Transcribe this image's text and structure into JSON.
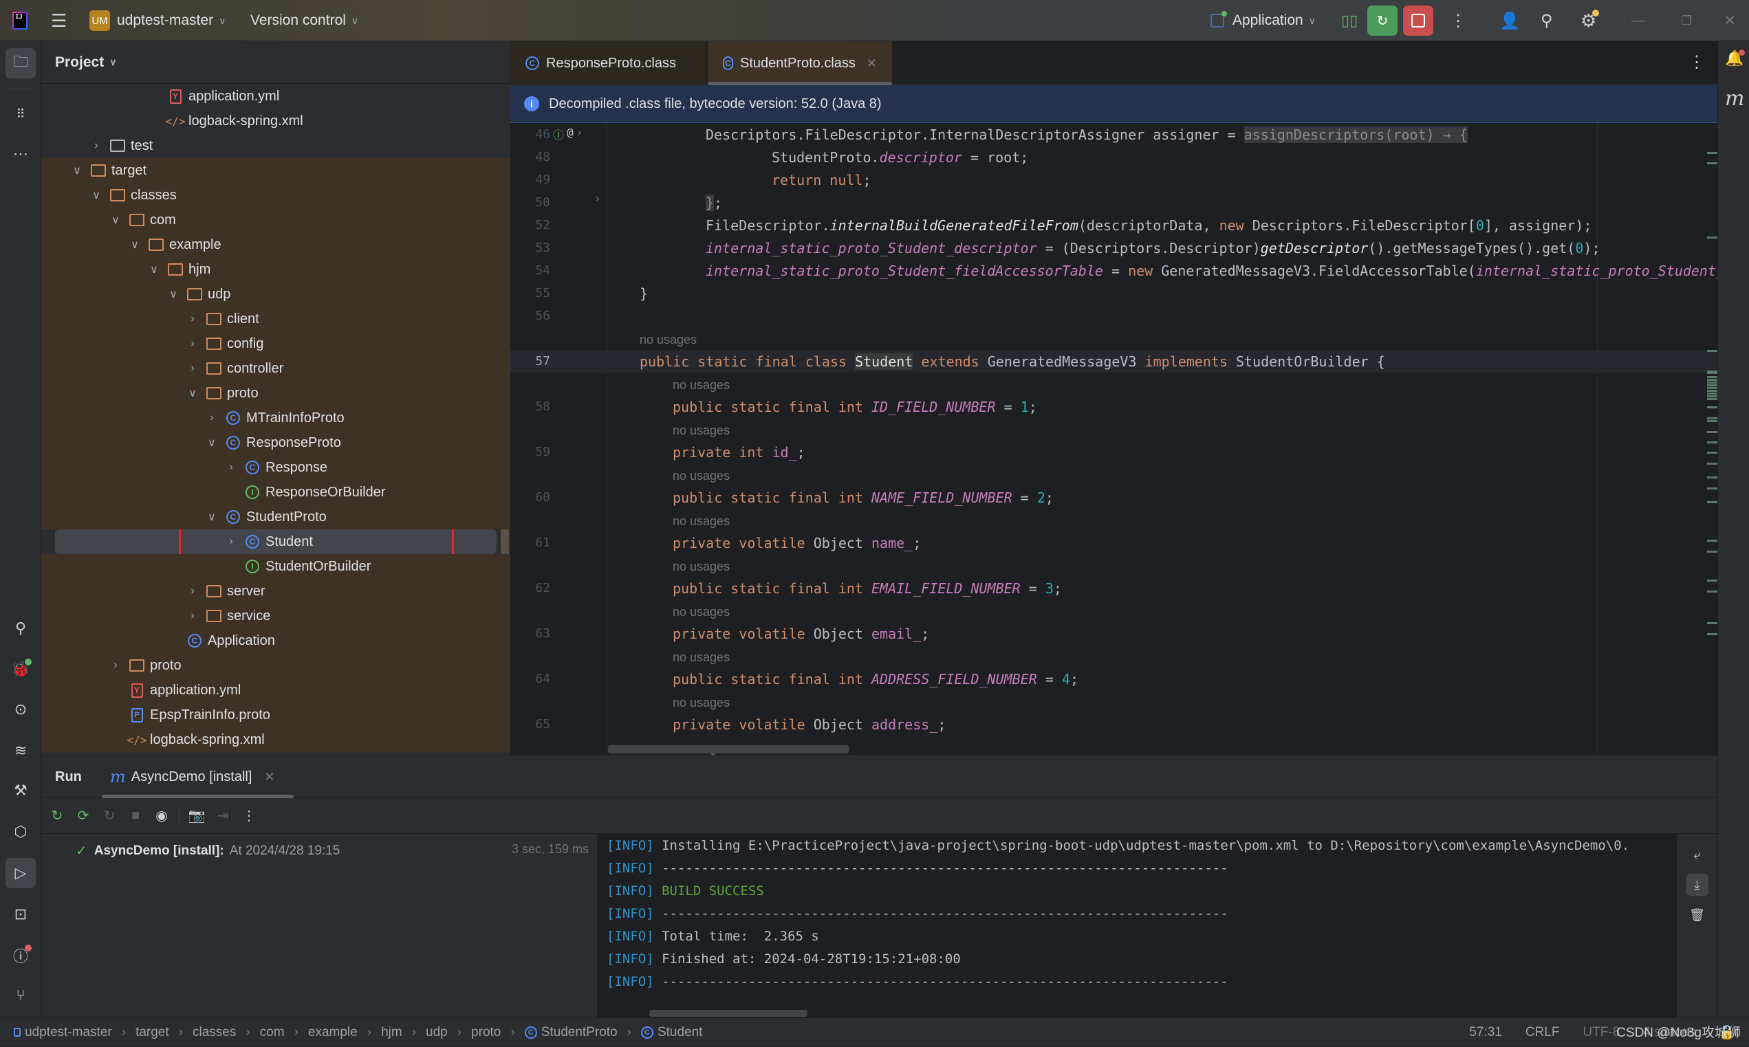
{
  "titlebar": {
    "project_badge": "UM",
    "project_name": "udptest-master",
    "vcs_label": "Version control",
    "run_config": "Application"
  },
  "colors": {
    "accent_blue": "#548af7",
    "interface_green": "#5fb865",
    "highlight_red": "#e8212b",
    "run_green": "#4e9a5b",
    "stop_red": "#c94f4f",
    "excluded_bg": "#3e3224"
  },
  "left_strip": {
    "top_icons": [
      "folder-icon",
      "structure-icon",
      "more-icon"
    ],
    "bottom_icons": [
      "search-icon",
      "debug-icon",
      "services-icon",
      "layers-icon",
      "build-icon",
      "endpoints-icon",
      "run-icon",
      "terminal-icon",
      "problems-icon",
      "git-icon"
    ]
  },
  "project": {
    "title": "Project",
    "tree": [
      {
        "label": "application.yml",
        "icon": "yml",
        "depth": 5,
        "arrow": "",
        "excluded": false
      },
      {
        "label": "logback-spring.xml",
        "icon": "xml",
        "depth": 5,
        "arrow": "",
        "excluded": false
      },
      {
        "label": "test",
        "icon": "folder-plain",
        "depth": 2,
        "arrow": "collapsed",
        "excluded": false
      },
      {
        "label": "target",
        "icon": "folder",
        "depth": 1,
        "arrow": "expanded",
        "excluded": true
      },
      {
        "label": "classes",
        "icon": "folder",
        "depth": 2,
        "arrow": "expanded",
        "excluded": true
      },
      {
        "label": "com",
        "icon": "folder",
        "depth": 3,
        "arrow": "expanded",
        "excluded": true
      },
      {
        "label": "example",
        "icon": "folder",
        "depth": 4,
        "arrow": "expanded",
        "excluded": true
      },
      {
        "label": "hjm",
        "icon": "folder",
        "depth": 5,
        "arrow": "expanded",
        "excluded": true
      },
      {
        "label": "udp",
        "icon": "folder",
        "depth": 6,
        "arrow": "expanded",
        "excluded": true
      },
      {
        "label": "client",
        "icon": "folder",
        "depth": 7,
        "arrow": "collapsed",
        "excluded": true
      },
      {
        "label": "config",
        "icon": "folder",
        "depth": 7,
        "arrow": "collapsed",
        "excluded": true
      },
      {
        "label": "controller",
        "icon": "folder",
        "depth": 7,
        "arrow": "collapsed",
        "excluded": true
      },
      {
        "label": "proto",
        "icon": "folder",
        "depth": 7,
        "arrow": "expanded",
        "excluded": true
      },
      {
        "label": "MTrainInfoProto",
        "icon": "class",
        "depth": 8,
        "arrow": "collapsed",
        "excluded": true
      },
      {
        "label": "ResponseProto",
        "icon": "class",
        "depth": 8,
        "arrow": "expanded",
        "excluded": true
      },
      {
        "label": "Response",
        "icon": "class",
        "depth": 9,
        "arrow": "collapsed",
        "excluded": true
      },
      {
        "label": "ResponseOrBuilder",
        "icon": "interface",
        "depth": 9,
        "arrow": "",
        "excluded": true
      },
      {
        "label": "StudentProto",
        "icon": "class",
        "depth": 8,
        "arrow": "expanded",
        "excluded": true
      },
      {
        "label": "Student",
        "icon": "class",
        "depth": 9,
        "arrow": "collapsed",
        "excluded": true,
        "selected": true
      },
      {
        "label": "StudentOrBuilder",
        "icon": "interface",
        "depth": 9,
        "arrow": "",
        "excluded": true
      },
      {
        "label": "server",
        "icon": "folder",
        "depth": 7,
        "arrow": "collapsed",
        "excluded": true
      },
      {
        "label": "service",
        "icon": "folder",
        "depth": 7,
        "arrow": "collapsed",
        "excluded": true
      },
      {
        "label": "Application",
        "icon": "class",
        "depth": 6,
        "arrow": "",
        "excluded": true
      },
      {
        "label": "proto",
        "icon": "folder",
        "depth": 3,
        "arrow": "collapsed",
        "excluded": true
      },
      {
        "label": "application.yml",
        "icon": "yml",
        "depth": 3,
        "arrow": "",
        "excluded": true
      },
      {
        "label": "EpspTrainInfo.proto",
        "icon": "proto",
        "depth": 3,
        "arrow": "",
        "excluded": true
      },
      {
        "label": "logback-spring.xml",
        "icon": "xml",
        "depth": 3,
        "arrow": "",
        "excluded": true
      }
    ]
  },
  "editor": {
    "tabs": [
      {
        "label": "ResponseProto.class",
        "active": false
      },
      {
        "label": "StudentProto.class",
        "active": true
      }
    ],
    "banner": "Decompiled .class file, bytecode version: 52.0 (Java 8)",
    "lines": [
      {
        "num": "46",
        "indent": 2,
        "hint": false,
        "tokens": [
          [
            "pl",
            "Descriptors.FileDescriptor.InternalDescriptorAssigner assigner = "
          ],
          [
            "fold",
            "assignDescriptors(root) → {"
          ]
        ]
      },
      {
        "num": "48",
        "indent": 4,
        "hint": false,
        "tokens": [
          [
            "pl",
            "StudentProto."
          ],
          [
            "fld",
            "descriptor"
          ],
          [
            "pl",
            " = root;"
          ]
        ]
      },
      {
        "num": "49",
        "indent": 4,
        "hint": false,
        "tokens": [
          [
            "kw",
            "return null"
          ],
          [
            "pl",
            ";"
          ]
        ]
      },
      {
        "num": "50",
        "indent": 2,
        "hint": false,
        "tokens": [
          [
            "fold",
            "}"
          ],
          [
            "pl",
            ";"
          ]
        ]
      },
      {
        "num": "52",
        "indent": 2,
        "hint": false,
        "tokens": [
          [
            "pl",
            "FileDescriptor."
          ],
          [
            "it",
            "internalBuildGeneratedFileFrom"
          ],
          [
            "pl",
            "(descriptorData, "
          ],
          [
            "kw",
            "new"
          ],
          [
            "pl",
            " Descriptors.FileDescriptor["
          ],
          [
            "num",
            "0"
          ],
          [
            "pl",
            "], assigner);"
          ]
        ]
      },
      {
        "num": "53",
        "indent": 2,
        "hint": false,
        "tokens": [
          [
            "fld",
            "internal_static_proto_Student_descriptor"
          ],
          [
            "pl",
            " = (Descriptors.Descriptor)"
          ],
          [
            "it",
            "getDescriptor"
          ],
          [
            "pl",
            "().getMessageTypes().get("
          ],
          [
            "num",
            "0"
          ],
          [
            "pl",
            ");"
          ]
        ]
      },
      {
        "num": "54",
        "indent": 2,
        "hint": false,
        "tokens": [
          [
            "fld",
            "internal_static_proto_Student_fieldAccessorTable"
          ],
          [
            "pl",
            " = "
          ],
          [
            "kw",
            "new"
          ],
          [
            "pl",
            " GeneratedMessageV3.FieldAccessorTable("
          ],
          [
            "fld",
            "internal_static_proto_Student_desc"
          ]
        ]
      },
      {
        "num": "55",
        "indent": 0,
        "hint": false,
        "tokens": [
          [
            "pl",
            "}"
          ]
        ]
      },
      {
        "num": "56",
        "indent": 0,
        "hint": false,
        "tokens": []
      },
      {
        "num": "",
        "indent": 0,
        "hint": true,
        "tokens": [
          [
            "hint",
            "no usages"
          ]
        ]
      },
      {
        "num": "57",
        "indent": 0,
        "hint": false,
        "current": true,
        "tokens": [
          [
            "kw",
            "public static final class "
          ],
          [
            "symhl",
            "Student"
          ],
          [
            "kw",
            " extends "
          ],
          [
            "pl",
            "GeneratedMessageV3"
          ],
          [
            "kw",
            " implements "
          ],
          [
            "pl",
            "StudentOrBuilder {"
          ]
        ]
      },
      {
        "num": "",
        "indent": 1,
        "hint": true,
        "tokens": [
          [
            "hint",
            "no usages"
          ]
        ]
      },
      {
        "num": "58",
        "indent": 1,
        "hint": false,
        "tokens": [
          [
            "kw",
            "public static final int "
          ],
          [
            "fld",
            "ID_FIELD_NUMBER"
          ],
          [
            "pl",
            " = "
          ],
          [
            "num",
            "1"
          ],
          [
            "pl",
            ";"
          ]
        ]
      },
      {
        "num": "",
        "indent": 1,
        "hint": true,
        "tokens": [
          [
            "hint",
            "no usages"
          ]
        ]
      },
      {
        "num": "59",
        "indent": 1,
        "hint": false,
        "tokens": [
          [
            "kw",
            "private int "
          ],
          [
            "ivar",
            "id_"
          ],
          [
            "pl",
            ";"
          ]
        ]
      },
      {
        "num": "",
        "indent": 1,
        "hint": true,
        "tokens": [
          [
            "hint",
            "no usages"
          ]
        ]
      },
      {
        "num": "60",
        "indent": 1,
        "hint": false,
        "tokens": [
          [
            "kw",
            "public static final int "
          ],
          [
            "fld",
            "NAME_FIELD_NUMBER"
          ],
          [
            "pl",
            " = "
          ],
          [
            "num",
            "2"
          ],
          [
            "pl",
            ";"
          ]
        ]
      },
      {
        "num": "",
        "indent": 1,
        "hint": true,
        "tokens": [
          [
            "hint",
            "no usages"
          ]
        ]
      },
      {
        "num": "61",
        "indent": 1,
        "hint": false,
        "tokens": [
          [
            "kw",
            "private volatile "
          ],
          [
            "pl",
            "Object "
          ],
          [
            "ivar",
            "name_"
          ],
          [
            "pl",
            ";"
          ]
        ]
      },
      {
        "num": "",
        "indent": 1,
        "hint": true,
        "tokens": [
          [
            "hint",
            "no usages"
          ]
        ]
      },
      {
        "num": "62",
        "indent": 1,
        "hint": false,
        "tokens": [
          [
            "kw",
            "public static final int "
          ],
          [
            "fld",
            "EMAIL_FIELD_NUMBER"
          ],
          [
            "pl",
            " = "
          ],
          [
            "num",
            "3"
          ],
          [
            "pl",
            ";"
          ]
        ]
      },
      {
        "num": "",
        "indent": 1,
        "hint": true,
        "tokens": [
          [
            "hint",
            "no usages"
          ]
        ]
      },
      {
        "num": "63",
        "indent": 1,
        "hint": false,
        "tokens": [
          [
            "kw",
            "private volatile "
          ],
          [
            "pl",
            "Object "
          ],
          [
            "ivar",
            "email_"
          ],
          [
            "pl",
            ";"
          ]
        ]
      },
      {
        "num": "",
        "indent": 1,
        "hint": true,
        "tokens": [
          [
            "hint",
            "no usages"
          ]
        ]
      },
      {
        "num": "64",
        "indent": 1,
        "hint": false,
        "tokens": [
          [
            "kw",
            "public static final int "
          ],
          [
            "fld",
            "ADDRESS_FIELD_NUMBER"
          ],
          [
            "pl",
            " = "
          ],
          [
            "num",
            "4"
          ],
          [
            "pl",
            ";"
          ]
        ]
      },
      {
        "num": "",
        "indent": 1,
        "hint": true,
        "tokens": [
          [
            "hint",
            "no usages"
          ]
        ]
      },
      {
        "num": "65",
        "indent": 1,
        "hint": false,
        "tokens": [
          [
            "kw",
            "private volatile "
          ],
          [
            "pl",
            "Object "
          ],
          [
            "ivar",
            "address_"
          ],
          [
            "pl",
            ";"
          ]
        ]
      },
      {
        "num": "",
        "indent": 1,
        "hint": true,
        "tokens": [
          [
            "hint",
            "no usages"
          ]
        ]
      }
    ]
  },
  "run": {
    "title": "Run",
    "tab_label": "AsyncDemo [install]",
    "node_label": "AsyncDemo [install]:",
    "node_time": "At 2024/4/28 19:15",
    "duration": "3 sec, 159 ms",
    "console": [
      {
        "tag": "[INFO]",
        "text": " Installing E:\\PracticeProject\\java-project\\spring-boot-udp\\udptest-master\\pom.xml to D:\\Repository\\com\\example\\AsyncDemo\\0.",
        "success": false
      },
      {
        "tag": "[INFO]",
        "text": " ------------------------------------------------------------------------",
        "success": false
      },
      {
        "tag": "[INFO]",
        "text": " BUILD SUCCESS",
        "success": true
      },
      {
        "tag": "[INFO]",
        "text": " ------------------------------------------------------------------------",
        "success": false
      },
      {
        "tag": "[INFO]",
        "text": " Total time:  2.365 s",
        "success": false
      },
      {
        "tag": "[INFO]",
        "text": " Finished at: 2024-04-28T19:15:21+08:00",
        "success": false
      },
      {
        "tag": "[INFO]",
        "text": " ------------------------------------------------------------------------",
        "success": false
      }
    ]
  },
  "statusbar": {
    "breadcrumbs": [
      {
        "label": "udptest-master",
        "icon": "module"
      },
      {
        "label": "target",
        "icon": ""
      },
      {
        "label": "classes",
        "icon": ""
      },
      {
        "label": "com",
        "icon": ""
      },
      {
        "label": "example",
        "icon": ""
      },
      {
        "label": "hjm",
        "icon": ""
      },
      {
        "label": "udp",
        "icon": ""
      },
      {
        "label": "proto",
        "icon": ""
      },
      {
        "label": "StudentProto",
        "icon": "class"
      },
      {
        "label": "Student",
        "icon": "class"
      }
    ],
    "position": "57:31",
    "line_separator": "CRLF",
    "encoding": "UTF-8",
    "indent": "4 spaces",
    "watermark": "CSDN @No8g攻城狮"
  }
}
